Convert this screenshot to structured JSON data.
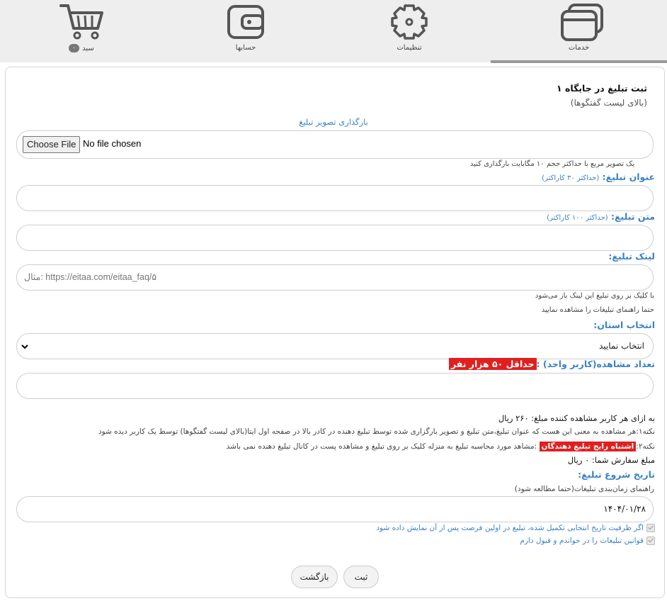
{
  "tabs": {
    "cart": {
      "label": "سبد",
      "badge": "۰"
    },
    "accounts": {
      "label": "حسابها"
    },
    "settings": {
      "label": "تنظیمات"
    },
    "services": {
      "label": "خدمات"
    }
  },
  "form": {
    "title": "ثبت تبلیغ در جایگاه ۱",
    "subtitle": "(بالای لیست گفتگوها)",
    "upload_link": "بارگذاری تصویر تبلیغ",
    "choose_file": "Choose File",
    "no_file": "No file chosen",
    "upload_hint": "یک تصویر مربع با حداکثر حجم ۱۰ مگابایت بارگذاری کنید",
    "ad_title_label": "عنوان تبلیغ:",
    "ad_title_hint": "(حداکثر ۳۰ کاراکتر)",
    "ad_text_label": "متن تبلیغ:",
    "ad_text_hint": "(حداکثر ۱۰۰ کاراکتر)",
    "link_label": "لینک تبلیغ:",
    "link_placeholder": "مثال: https://eitaa.com/eitaa_faq/۵",
    "link_hint1": "با کلیک بر روی تبلیغ این لینک باز می‌شود",
    "link_hint2": "حتما راهنمای تبلیغات را مشاهده نمایید",
    "province_label": "انتخاب استان:",
    "province_value": "انتخاب نمایید",
    "views_label": "تعداد مشاهده(کاربر واحد) :",
    "views_min": "حداقل ۵۰ هزار نفر",
    "price_line": "به ازای هر کاربر مشاهده کننده مبلغ: ۲۶۰ ریال",
    "note1": "نکته۱:هر مشاهده به معنی این هست که عنوان تبلیغ،متن تبلیغ و تصویر بارگزاری شده توسط تبلیغ دهنده در کادر بالا در صفحه اول ایتا(بالای لیست گفتگوها) توسط یک کاربر دیده شود",
    "note2_prefix": "نکته۲:",
    "note2_highlight": "اشتباه رایج تبلیغ دهندگان",
    "note2_rest": " :مشاهد مورد محاسبه تبلیغ به منزله کلیک بر روی تبلیغ و مشاهده پست در کانال تبلیغ دهنده نمی باشد",
    "order_amount": "مبلغ سفارش شما: ۰ ریال",
    "start_date_label": "تاریخ شروع تبلیغ:",
    "schedule_guide": "راهنمای زمان‌بندی تبلیغات(حتما مطالعه شود)",
    "start_date_value": "۱۴۰۴/۰۱/۲۸",
    "check1": "اگر ظرفیت تاریخ انتخابی تکمیل شده، تبلیغ در اولین فرصت پس از آن نمایش داده شود",
    "check2": "قوانین تبلیغات را در خواندم و قبول دارم",
    "submit": "ثبت",
    "back": "بازگشت"
  },
  "colors": {
    "accent": "#3b82c4",
    "warning": "#e02020",
    "topbar": "#eeeeee"
  }
}
